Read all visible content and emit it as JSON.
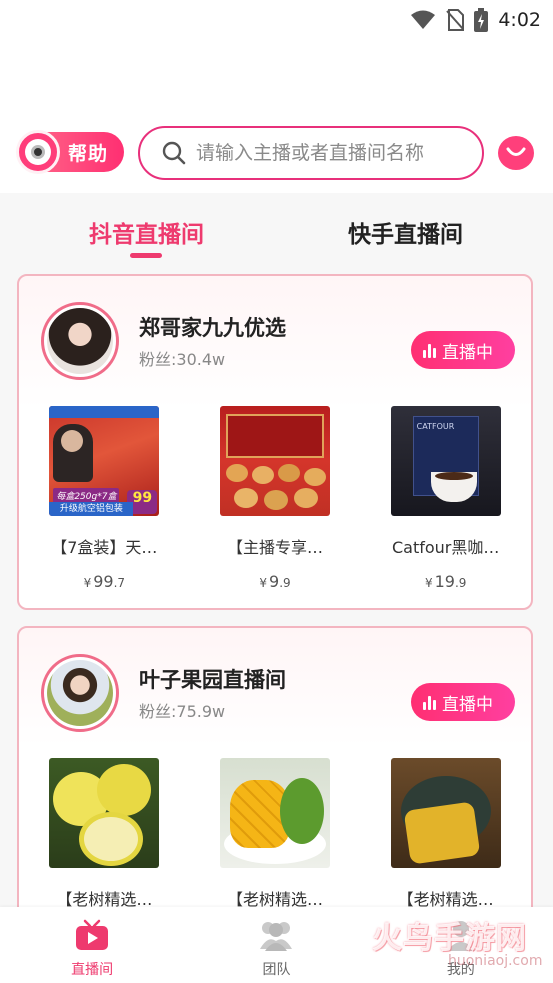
{
  "status_bar": {
    "time": "4:02",
    "icons": [
      "wifi-icon",
      "no-sim-icon",
      "battery-charging-icon"
    ]
  },
  "header": {
    "help_label": "帮助",
    "search_placeholder": "请输入主播或者直播间名称",
    "icons": [
      "camera-icon",
      "search-icon",
      "chat-icon"
    ]
  },
  "tabs": [
    {
      "label": "抖音直播间",
      "active": true
    },
    {
      "label": "快手直播间",
      "active": false
    }
  ],
  "rooms": [
    {
      "host_name": "郑哥家九九优选",
      "fans": "粉丝:30.4w",
      "live_label": "直播中",
      "products": [
        {
          "name": "【7盒装】天…",
          "price_int": "99",
          "price_dec": ".7"
        },
        {
          "name": "【主播专享…",
          "price_int": "9",
          "price_dec": ".9"
        },
        {
          "name": "Catfour黑咖…",
          "price_int": "19",
          "price_dec": ".9"
        }
      ],
      "image_text": {
        "p1_tag": "每盒250g*7盒",
        "p1_sub": "升级航空铝包装",
        "p1_price": "99",
        "p3_brand": "CATFOUR"
      }
    },
    {
      "host_name": "叶子果园直播间",
      "fans": "粉丝:75.9w",
      "live_label": "直播中",
      "products": [
        {
          "name": "【老树精选…"
        },
        {
          "name": "【老树精选…"
        },
        {
          "name": "【老树精选…"
        }
      ]
    }
  ],
  "currency_symbol": "¥",
  "bottom_nav": [
    {
      "label": "直播间",
      "icon": "tv-play-icon",
      "active": true
    },
    {
      "label": "团队",
      "icon": "team-icon",
      "active": false
    },
    {
      "label": "我的",
      "icon": "profile-icon",
      "active": false
    }
  ],
  "watermark": {
    "text": "火鸟手游网",
    "sub": "huoniaoj.com"
  },
  "colors": {
    "accent": "#ee3a6e",
    "card_border": "#f3b5c0",
    "live_badge": "#ff2f72"
  }
}
